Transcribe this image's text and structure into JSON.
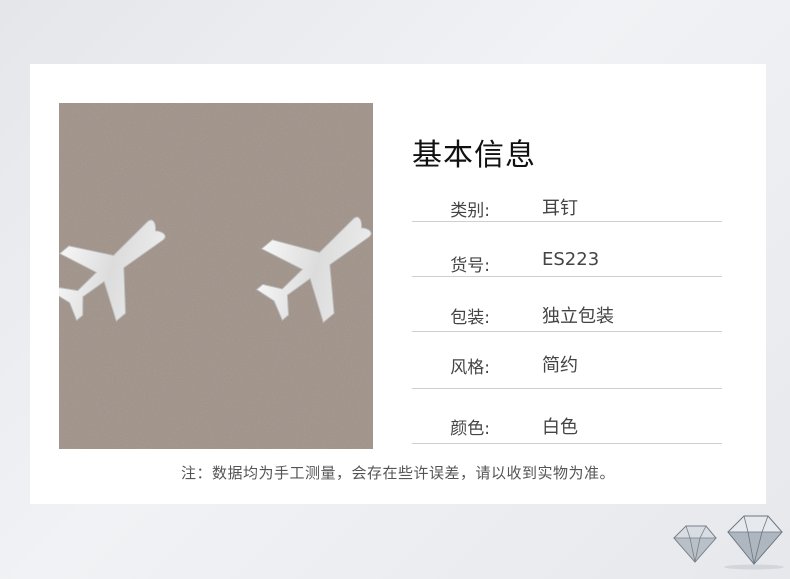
{
  "section_title": "基本信息",
  "rows": [
    {
      "label": "类别:",
      "value": "耳钉"
    },
    {
      "label": "货号:",
      "value": "ES223"
    },
    {
      "label": "包装:",
      "value": "独立包装"
    },
    {
      "label": "风格:",
      "value": "简约"
    },
    {
      "label": "颜色:",
      "value": "白色"
    }
  ],
  "note": "注：数据均为手工测量，会存在些许误差，请以收到实物为准。",
  "photo_background_color": "#9a8d84",
  "earring_color": "#e8e8e8"
}
